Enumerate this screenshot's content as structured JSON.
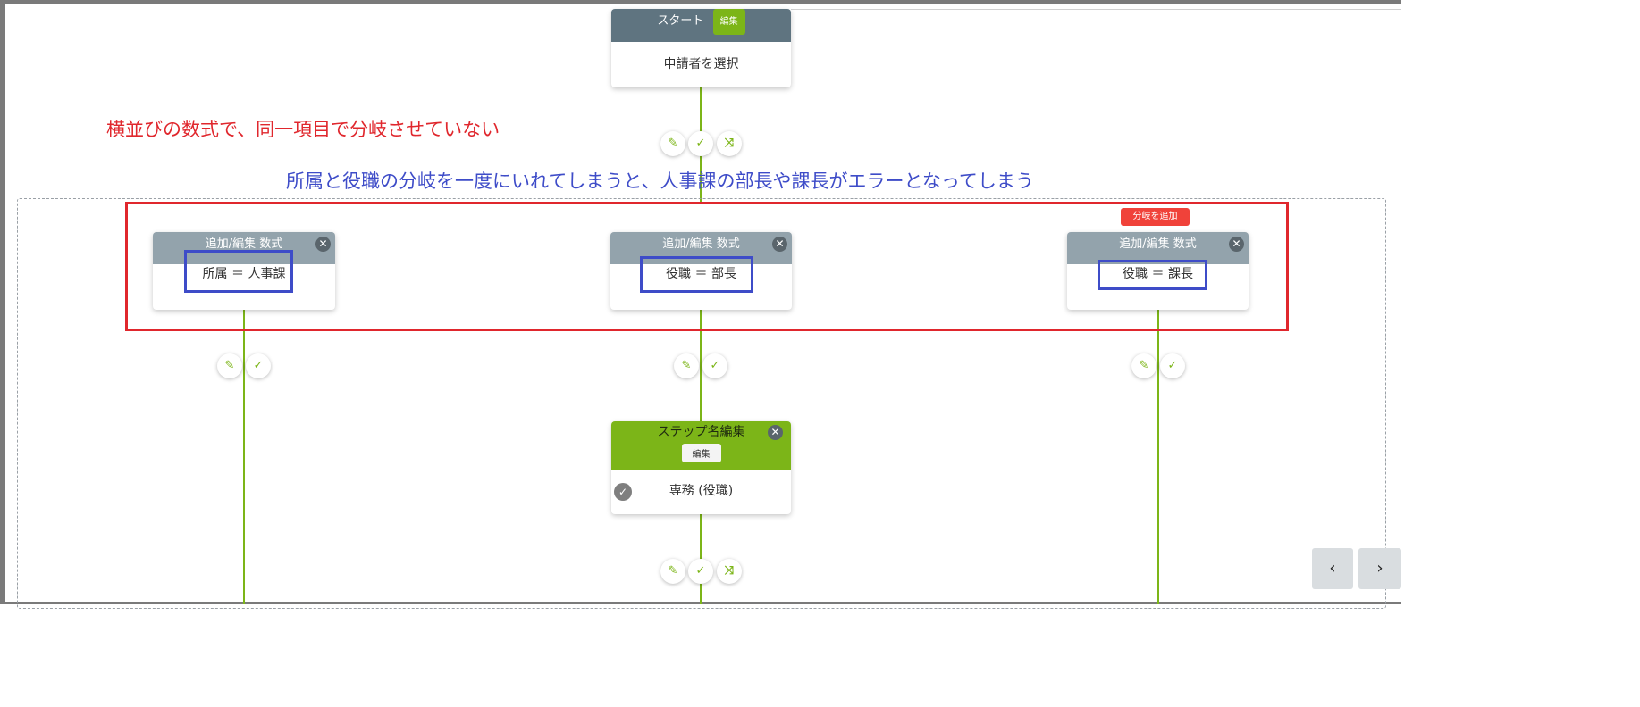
{
  "start_node": {
    "title": "スタート",
    "edit_badge": "編集",
    "body": "申請者を選択"
  },
  "annotations": {
    "red": "横並びの数式で、同一項目で分岐させていない",
    "blue": "所属と役職の分岐を一度にいれてしまうと、人事課の部長や課長がエラーとなってしまう"
  },
  "add_branch_label": "分岐を追加",
  "branches": [
    {
      "header": "追加/編集 数式",
      "condition": "所属 ＝ 人事課"
    },
    {
      "header": "追加/編集 数式",
      "condition": "役職 ＝ 部長"
    },
    {
      "header": "追加/編集 数式",
      "condition": "役職 ＝ 課長"
    }
  ],
  "step_node": {
    "title": "ステップ名編集",
    "edit_badge": "編集",
    "body": "専務 (役職)"
  },
  "icons": {
    "edit": "pencil-icon",
    "confirm": "check-icon",
    "shuffle": "shuffle-icon",
    "close": "close-icon",
    "prev": "chevron-left-icon",
    "next": "chevron-right-icon"
  },
  "colors": {
    "accent_green": "#7cb518",
    "node_header_dark": "#5f7480",
    "node_header_light": "#93a3ac",
    "annotation_red": "#e0272d",
    "annotation_blue": "#3e4cc8",
    "add_branch_red": "#f0423a"
  }
}
